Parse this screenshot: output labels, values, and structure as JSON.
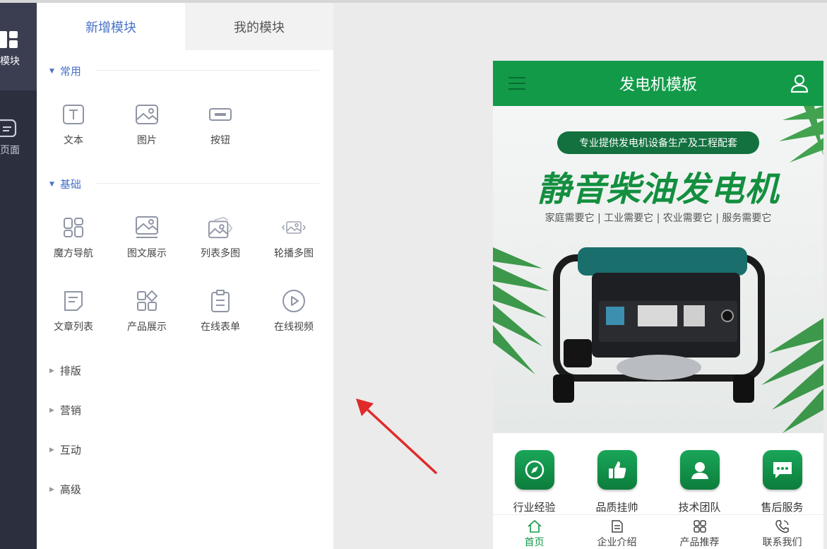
{
  "rail": {
    "items": [
      {
        "label": "模块",
        "icon": "module-grid-icon",
        "active": true
      },
      {
        "label": "页面",
        "icon": "page-icon",
        "active": false
      }
    ]
  },
  "panel": {
    "tabs": [
      {
        "label": "新增模块",
        "active": true
      },
      {
        "label": "我的模块",
        "active": false
      }
    ],
    "sections": {
      "common": {
        "title": "常用",
        "items": [
          {
            "label": "文本",
            "icon": "text-icon"
          },
          {
            "label": "图片",
            "icon": "image-icon"
          },
          {
            "label": "按钮",
            "icon": "button-icon"
          }
        ]
      },
      "basic": {
        "title": "基础",
        "items": [
          {
            "label": "魔方导航",
            "icon": "cube-nav-icon"
          },
          {
            "label": "图文展示",
            "icon": "image-text-icon"
          },
          {
            "label": "列表多图",
            "icon": "multi-image-list-icon"
          },
          {
            "label": "轮播多图",
            "icon": "carousel-icon"
          },
          {
            "label": "文章列表",
            "icon": "article-list-icon"
          },
          {
            "label": "产品展示",
            "icon": "product-icon"
          },
          {
            "label": "在线表单",
            "icon": "form-icon"
          },
          {
            "label": "在线视频",
            "icon": "video-icon"
          }
        ]
      },
      "collapsed": [
        {
          "title": "排版"
        },
        {
          "title": "营销"
        },
        {
          "title": "互动"
        },
        {
          "title": "高级"
        }
      ]
    }
  },
  "phone": {
    "title": "发电机模板",
    "banner": {
      "pill": "专业提供发电机设备生产及工程配套",
      "headline": "静音柴油发电机",
      "subtitle": "家庭需要它 | 工业需要它 | 农业需要它 | 服务需要它"
    },
    "features": [
      {
        "label": "行业经验",
        "icon": "compass-icon"
      },
      {
        "label": "品质挂帅",
        "icon": "thumbs-up-icon"
      },
      {
        "label": "技术团队",
        "icon": "person-icon"
      },
      {
        "label": "售后服务",
        "icon": "chat-icon"
      }
    ],
    "tabbar": [
      {
        "label": "首页",
        "icon": "home-icon",
        "active": true
      },
      {
        "label": "企业介绍",
        "icon": "document-icon",
        "active": false
      },
      {
        "label": "产品推荐",
        "icon": "grid-icon",
        "active": false
      },
      {
        "label": "联系我们",
        "icon": "phone-icon",
        "active": false
      }
    ]
  },
  "colors": {
    "accent": "#4a72c9",
    "brand_green": "#129a49",
    "rail_bg": "#2b2f3e",
    "arrow_red": "#e02a2a"
  }
}
